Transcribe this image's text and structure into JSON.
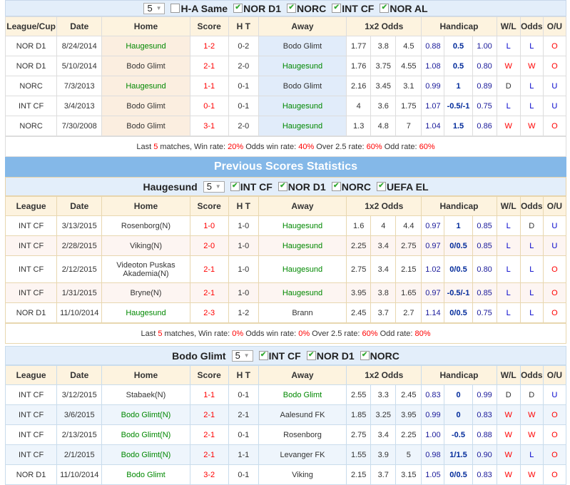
{
  "h2h": {
    "count": "5",
    "ha_same": "H-A Same",
    "filters": [
      "NOR D1",
      "NORC",
      "INT CF",
      "NOR AL"
    ],
    "headers": [
      "League/Cup",
      "Date",
      "Home",
      "Score",
      "H T",
      "Away",
      "1x2 Odds",
      "Handicap",
      "W/L",
      "Odds",
      "O/U"
    ],
    "rows": [
      {
        "league": "NOR D1",
        "date": "8/24/2014",
        "home": "Haugesund",
        "score": "1-2",
        "ht": "0-2",
        "away": "Bodo Glimt",
        "o1": "1.77",
        "ox": "3.8",
        "o2": "4.5",
        "h1": "0.88",
        "hc": "0.5",
        "h2": "1.00",
        "wl": "L",
        "odds": "L",
        "ou": "O",
        "green": "home"
      },
      {
        "league": "NOR D1",
        "date": "5/10/2014",
        "home": "Bodo Glimt",
        "score": "2-1",
        "ht": "2-0",
        "away": "Haugesund",
        "o1": "1.76",
        "ox": "3.75",
        "o2": "4.55",
        "h1": "1.08",
        "hc": "0.5",
        "h2": "0.80",
        "wl": "W",
        "odds": "W",
        "ou": "O",
        "green": "away"
      },
      {
        "league": "NORC",
        "date": "7/3/2013",
        "home": "Haugesund",
        "score": "1-1",
        "ht": "0-1",
        "away": "Bodo Glimt",
        "o1": "2.16",
        "ox": "3.45",
        "o2": "3.1",
        "h1": "0.99",
        "hc": "1",
        "h2": "0.89",
        "wl": "D",
        "odds": "L",
        "ou": "U",
        "green": "home"
      },
      {
        "league": "INT CF",
        "date": "3/4/2013",
        "home": "Bodo Glimt",
        "score": "0-1",
        "ht": "0-1",
        "away": "Haugesund",
        "o1": "4",
        "ox": "3.6",
        "o2": "1.75",
        "h1": "1.07",
        "hc": "-0.5/-1",
        "h2": "0.75",
        "wl": "L",
        "odds": "L",
        "ou": "U",
        "green": "away"
      },
      {
        "league": "NORC",
        "date": "7/30/2008",
        "home": "Bodo Glimt",
        "score": "3-1",
        "ht": "2-0",
        "away": "Haugesund",
        "o1": "1.3",
        "ox": "4.8",
        "o2": "7",
        "h1": "1.04",
        "hc": "1.5",
        "h2": "0.86",
        "wl": "W",
        "odds": "W",
        "ou": "O",
        "green": "away"
      }
    ],
    "summary": {
      "last": "Last ",
      "n": "5",
      "matches": " matches, Win rate: ",
      "win": "20%",
      "odds_l": " Odds win rate: ",
      "odds": "40%",
      "over_l": " Over 2.5 rate: ",
      "over": "60%",
      "odd_l": " Odd rate: ",
      "odd": "60%"
    }
  },
  "section_title": "Previous Scores Statistics",
  "home_team": {
    "name": "Haugesund",
    "count": "5",
    "filters": [
      "INT CF",
      "NOR D1",
      "NORC",
      "UEFA EL"
    ],
    "headers": [
      "League",
      "Date",
      "Home",
      "Score",
      "H T",
      "Away",
      "1x2 Odds",
      "Handicap",
      "W/L",
      "Odds",
      "O/U"
    ],
    "rows": [
      {
        "league": "INT CF",
        "date": "3/13/2015",
        "home": "Rosenborg(N)",
        "score": "1-0",
        "ht": "1-0",
        "away": "Haugesund",
        "o1": "1.6",
        "ox": "4",
        "o2": "4.4",
        "h1": "0.97",
        "hc": "1",
        "h2": "0.85",
        "wl": "L",
        "odds": "D",
        "ou": "U",
        "green": "away"
      },
      {
        "league": "INT CF",
        "date": "2/28/2015",
        "home": "Viking(N)",
        "score": "2-0",
        "ht": "1-0",
        "away": "Haugesund",
        "o1": "2.25",
        "ox": "3.4",
        "o2": "2.75",
        "h1": "0.97",
        "hc": "0/0.5",
        "h2": "0.85",
        "wl": "L",
        "odds": "L",
        "ou": "U",
        "green": "away"
      },
      {
        "league": "INT CF",
        "date": "2/12/2015",
        "home": "Videoton Puskas Akademia(N)",
        "score": "2-1",
        "ht": "1-0",
        "away": "Haugesund",
        "o1": "2.75",
        "ox": "3.4",
        "o2": "2.15",
        "h1": "1.02",
        "hc": "0/0.5",
        "h2": "0.80",
        "wl": "L",
        "odds": "L",
        "ou": "O",
        "green": "away"
      },
      {
        "league": "INT CF",
        "date": "1/31/2015",
        "home": "Bryne(N)",
        "score": "2-1",
        "ht": "1-0",
        "away": "Haugesund",
        "o1": "3.95",
        "ox": "3.8",
        "o2": "1.65",
        "h1": "0.97",
        "hc": "-0.5/-1",
        "h2": "0.85",
        "wl": "L",
        "odds": "L",
        "ou": "O",
        "green": "away"
      },
      {
        "league": "NOR D1",
        "date": "11/10/2014",
        "home": "Haugesund",
        "score": "2-3",
        "ht": "1-2",
        "away": "Brann",
        "o1": "2.45",
        "ox": "3.7",
        "o2": "2.7",
        "h1": "1.14",
        "hc": "0/0.5",
        "h2": "0.75",
        "wl": "L",
        "odds": "L",
        "ou": "O",
        "green": "home"
      }
    ],
    "summary": {
      "last": "Last ",
      "n": "5",
      "matches": " matches, Win rate: ",
      "win": "0%",
      "odds_l": " Odds win rate: ",
      "odds": "0%",
      "over_l": " Over 2.5 rate: ",
      "over": "60%",
      "odd_l": " Odd rate: ",
      "odd": "80%"
    }
  },
  "away_team": {
    "name": "Bodo Glimt",
    "count": "5",
    "filters": [
      "INT CF",
      "NOR D1",
      "NORC"
    ],
    "headers": [
      "League",
      "Date",
      "Home",
      "Score",
      "H T",
      "Away",
      "1x2 Odds",
      "Handicap",
      "W/L",
      "Odds",
      "O/U"
    ],
    "rows": [
      {
        "league": "INT CF",
        "date": "3/12/2015",
        "home": "Stabaek(N)",
        "score": "1-1",
        "ht": "0-1",
        "away": "Bodo Glimt",
        "o1": "2.55",
        "ox": "3.3",
        "o2": "2.45",
        "h1": "0.83",
        "hc": "0",
        "h2": "0.99",
        "wl": "D",
        "odds": "D",
        "ou": "U",
        "green": "away"
      },
      {
        "league": "INT CF",
        "date": "3/6/2015",
        "home": "Bodo Glimt(N)",
        "score": "2-1",
        "ht": "2-1",
        "away": "Aalesund FK",
        "o1": "1.85",
        "ox": "3.25",
        "o2": "3.95",
        "h1": "0.99",
        "hc": "0",
        "h2": "0.83",
        "wl": "W",
        "odds": "W",
        "ou": "O",
        "green": "home"
      },
      {
        "league": "INT CF",
        "date": "2/13/2015",
        "home": "Bodo Glimt(N)",
        "score": "2-1",
        "ht": "0-1",
        "away": "Rosenborg",
        "o1": "2.75",
        "ox": "3.4",
        "o2": "2.25",
        "h1": "1.00",
        "hc": "-0.5",
        "h2": "0.88",
        "wl": "W",
        "odds": "W",
        "ou": "O",
        "green": "home"
      },
      {
        "league": "INT CF",
        "date": "2/1/2015",
        "home": "Bodo Glimt(N)",
        "score": "2-1",
        "ht": "1-1",
        "away": "Levanger FK",
        "o1": "1.55",
        "ox": "3.9",
        "o2": "5",
        "h1": "0.98",
        "hc": "1/1.5",
        "h2": "0.90",
        "wl": "W",
        "odds": "L",
        "ou": "O",
        "green": "home"
      },
      {
        "league": "NOR D1",
        "date": "11/10/2014",
        "home": "Bodo Glimt",
        "score": "3-2",
        "ht": "0-1",
        "away": "Viking",
        "o1": "2.15",
        "ox": "3.7",
        "o2": "3.15",
        "h1": "1.05",
        "hc": "0/0.5",
        "h2": "0.83",
        "wl": "W",
        "odds": "W",
        "ou": "O",
        "green": "home"
      }
    ]
  }
}
